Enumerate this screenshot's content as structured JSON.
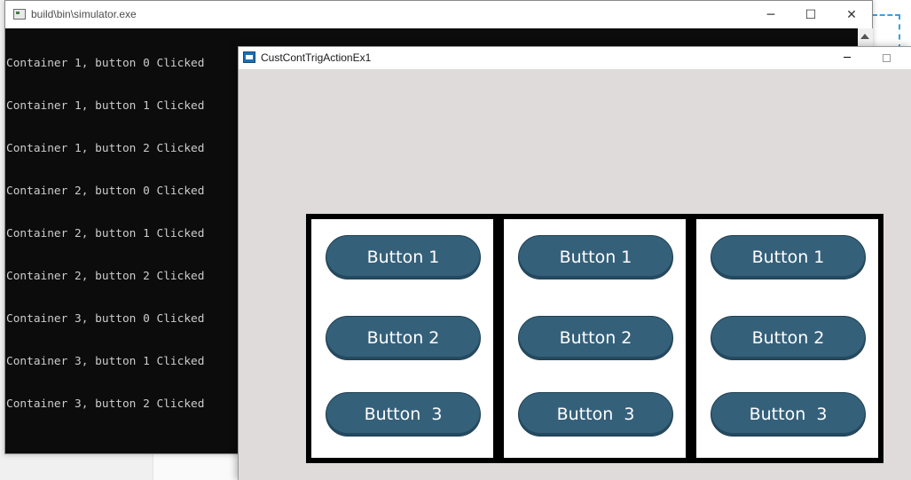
{
  "console": {
    "title": "build\\bin\\simulator.exe",
    "controls": {
      "minimize": "─",
      "maximize": "☐",
      "close": "✕"
    },
    "lines": [
      "Container 1, button 0 Clicked",
      "Container 1, button 1 Clicked",
      "Container 1, button 2 Clicked",
      "Container 2, button 0 Clicked",
      "Container 2, button 1 Clicked",
      "Container 2, button 2 Clicked",
      "Container 3, button 0 Clicked",
      "Container 3, button 1 Clicked",
      "Container 3, button 2 Clicked"
    ]
  },
  "app": {
    "title": "CustContTrigActionEx1",
    "controls": {
      "minimize": "─"
    },
    "containers": [
      {
        "buttons": [
          "Button 1",
          "Button 2",
          "Button  3"
        ]
      },
      {
        "buttons": [
          "Button 1",
          "Button 2",
          "Button  3"
        ]
      },
      {
        "buttons": [
          "Button 1",
          "Button 2",
          "Button  3"
        ]
      }
    ]
  },
  "colors": {
    "button_fill": "#35607a",
    "app_background": "#e0dbdb",
    "console_background": "#0c0c0c"
  }
}
